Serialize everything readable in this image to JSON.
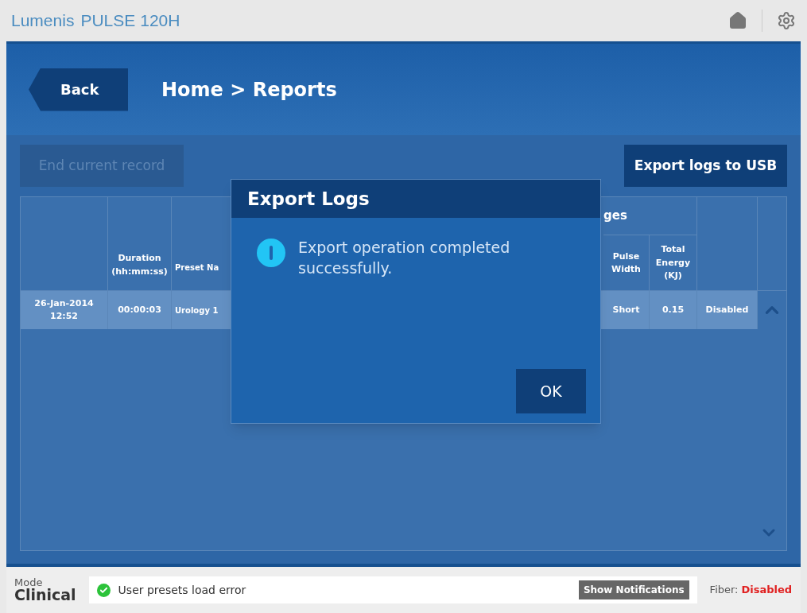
{
  "app": {
    "brand": "Lumenis",
    "product": "PULSE",
    "model": "120H"
  },
  "header": {
    "back": "Back",
    "breadcrumb": "Home > Reports"
  },
  "actions": {
    "end_record": {
      "label": "End current record",
      "disabled": true
    },
    "export": {
      "label": "Export logs to USB"
    }
  },
  "table": {
    "group_header": "ges",
    "columns": [
      "Duration (hh:mm:ss)",
      "Preset Na",
      "Pulse Width",
      "Total Energy (KJ)"
    ],
    "rows": [
      {
        "date": "26-Jan-2014 12:52",
        "duration": "00:00:03",
        "preset": "Urology 1",
        "pulse_width": "Short",
        "energy": "0.15",
        "status": "Disabled",
        "selected": true
      }
    ]
  },
  "dialog": {
    "title": "Export Logs",
    "message": "Export operation completed successfully.",
    "ok": "OK"
  },
  "status_bar": {
    "mode_label": "Mode",
    "mode": "Clinical",
    "notification": "User presets load error",
    "show_notifications": "Show Notifications",
    "fiber_label": "Fiber:",
    "fiber_value": "Disabled"
  }
}
